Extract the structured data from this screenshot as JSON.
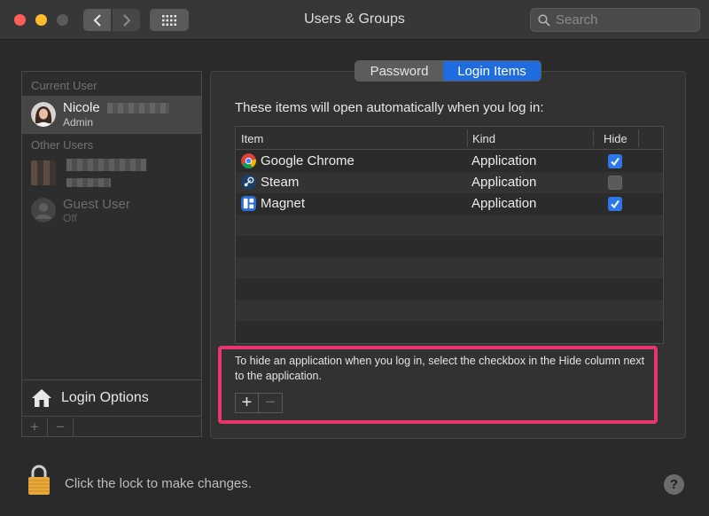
{
  "window": {
    "title": "Users & Groups",
    "search_placeholder": "Search"
  },
  "sidebar": {
    "current_user_label": "Current User",
    "current_user": {
      "name": "Nicole",
      "role": "Admin"
    },
    "other_users_label": "Other Users",
    "guest_user": {
      "name": "Guest User",
      "status": "Off"
    },
    "login_options_label": "Login Options"
  },
  "tabs": [
    {
      "label": "Password",
      "selected": false
    },
    {
      "label": "Login Items",
      "selected": true
    }
  ],
  "main": {
    "intro": "These items will open automatically when you log in:",
    "columns": {
      "item": "Item",
      "kind": "Kind",
      "hide": "Hide"
    },
    "rows": [
      {
        "item": "Google Chrome",
        "kind": "Application",
        "hide": true,
        "icon": "chrome-icon"
      },
      {
        "item": "Steam",
        "kind": "Application",
        "hide": false,
        "icon": "steam-icon"
      },
      {
        "item": "Magnet",
        "kind": "Application",
        "hide": true,
        "icon": "magnet-icon"
      }
    ],
    "help_text": "To hide an application when you log in, select the checkbox in the Hide column next to the application.",
    "highlight_color": "#e8356b",
    "accent_color": "#1f6cde"
  },
  "footer": {
    "lock_text": "Click the lock to make changes.",
    "help_symbol": "?"
  }
}
